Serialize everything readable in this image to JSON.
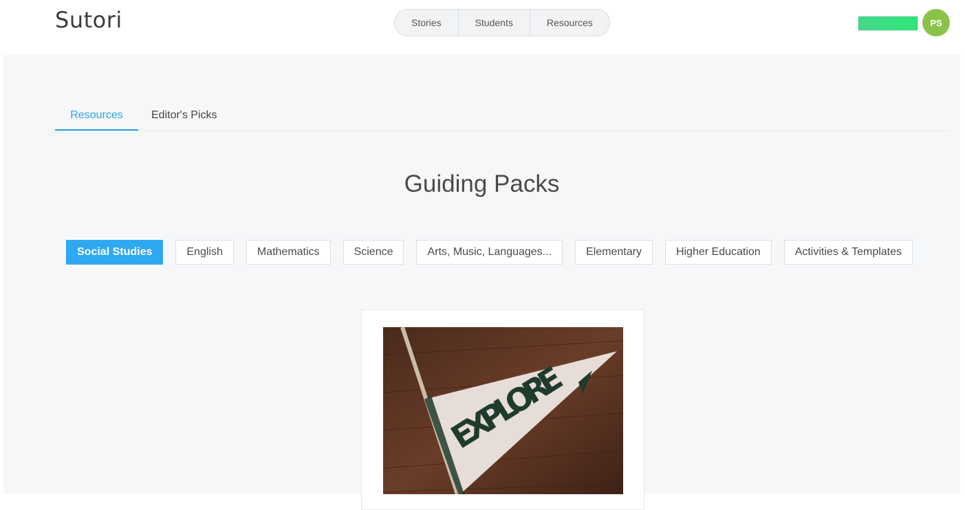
{
  "app": {
    "logo_text": "Sutori"
  },
  "topnav": {
    "items": [
      "Stories",
      "Students",
      "Resources"
    ]
  },
  "user": {
    "initials": "PS",
    "avatar_color": "#8bc34a"
  },
  "subtabs": {
    "items": [
      "Resources",
      "Editor's Picks"
    ],
    "active": "Resources"
  },
  "page": {
    "title": "Guiding Packs"
  },
  "filters": {
    "items": [
      "Social Studies",
      "English",
      "Mathematics",
      "Science",
      "Arts, Music, Languages...",
      "Elementary",
      "Higher Education",
      "Activities & Templates"
    ],
    "active": "Social Studies"
  },
  "card": {
    "image_text": "EXPLORE",
    "image_icon": "pennant-flag-image"
  },
  "colors": {
    "accent": "#2fa8f2",
    "tab_active": "#2aa3e8",
    "green_bar": "#2ee67a"
  }
}
